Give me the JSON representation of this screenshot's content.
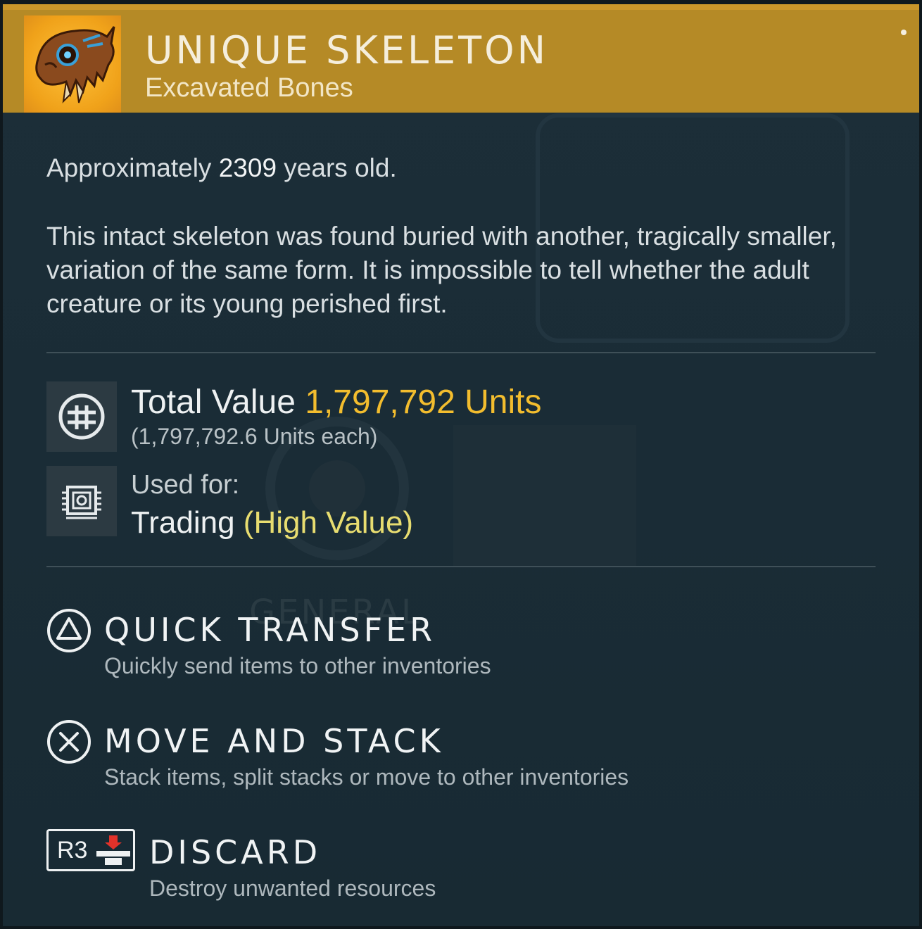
{
  "header": {
    "title": "UNIQUE SKELETON",
    "subtitle": "Excavated Bones",
    "accent": "#b58a26",
    "icon": "skull-icon"
  },
  "details": {
    "age_prefix": "Approximately ",
    "age_number": "2309",
    "age_suffix": " years old.",
    "description": "This intact skeleton was found buried with another, tragically smaller, variation of the same form. It is impossible to tell whether the adult creature or its young perished first."
  },
  "value": {
    "label": "Total Value ",
    "amount": "1,797,792 Units",
    "each": "(1,797,792.6 Units each)",
    "icon": "units-currency-icon",
    "accent": "#f3bd2e"
  },
  "usage": {
    "label": "Used for:",
    "value": "Trading",
    "qualifier": " (High Value)",
    "icon": "trade-chip-icon",
    "qualifier_color": "#e8dd70"
  },
  "background_text": "GENERAL",
  "actions": [
    {
      "button": "triangle-button-icon",
      "title": "QUICK TRANSFER",
      "desc": "Quickly send items to other inventories"
    },
    {
      "button": "cross-button-icon",
      "title": "MOVE AND STACK",
      "desc": "Stack items, split stacks or move to other inventories"
    },
    {
      "button": "r3-button-icon",
      "button_label": "R3",
      "title": "DISCARD",
      "desc": "Destroy unwanted resources"
    }
  ]
}
